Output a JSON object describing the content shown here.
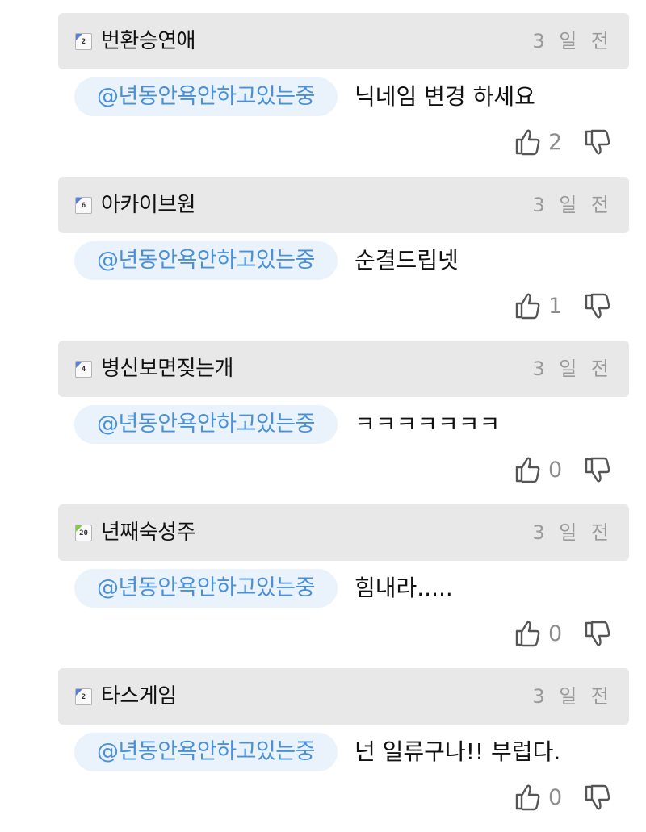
{
  "comments": [
    {
      "level": "2",
      "level_color": "#5a7fd6",
      "nickname": "번환승연애",
      "time": "3 일 전",
      "mention": "@년동안욕안하고있는중",
      "text": "닉네임 변경 하세요",
      "likes": "2"
    },
    {
      "level": "6",
      "level_color": "#5a7fd6",
      "nickname": "아카이브원",
      "time": "3 일 전",
      "mention": "@년동안욕안하고있는중",
      "text": "순결드립넷",
      "likes": "1"
    },
    {
      "level": "4",
      "level_color": "#5a7fd6",
      "nickname": "병신보면짖는개",
      "time": "3 일 전",
      "mention": "@년동안욕안하고있는중",
      "text": "ㅋㅋㅋㅋㅋㅋㅋ",
      "likes": "0"
    },
    {
      "level": "20",
      "level_color": "#7ccf3a",
      "nickname": "년째숙성주",
      "time": "3 일 전",
      "mention": "@년동안욕안하고있는중",
      "text": "힘내라.....",
      "likes": "0"
    },
    {
      "level": "2",
      "level_color": "#5a7fd6",
      "nickname": "타스게임",
      "time": "3 일 전",
      "mention": "@년동안욕안하고있는중",
      "text": "넌 일류구나!! 부럽다.",
      "likes": "0"
    }
  ],
  "icons": {
    "like": "thumbs-up-icon",
    "dislike": "thumbs-down-icon"
  }
}
